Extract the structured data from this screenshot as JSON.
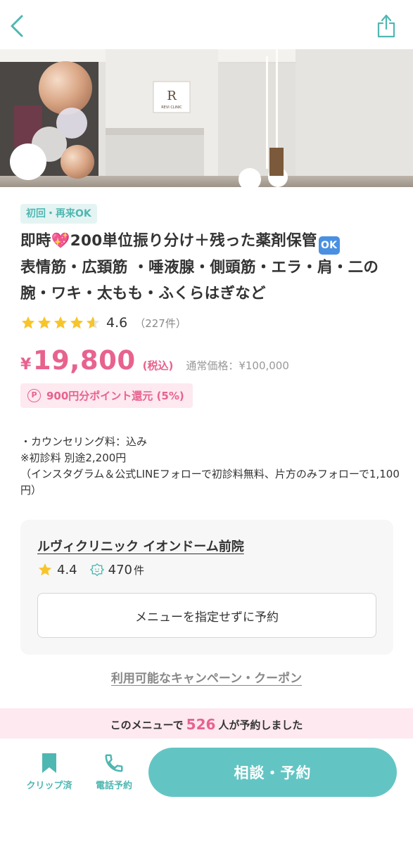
{
  "topbar": {
    "back_icon": "chevron-left-icon",
    "share_icon": "share-icon",
    "accent": "#4fb7b2"
  },
  "hero": {
    "logo_text": "REVI CLINIC",
    "logo_mark": "R"
  },
  "menu": {
    "badge": "初回・再来OK",
    "title_part1": "即時",
    "title_emoji1": "💖",
    "title_part2": "200単位振り分け＋残った薬剤保管",
    "title_emoji2": "OK",
    "title_part3": "表情筋・広頚筋 ・唾液腺・側頭筋・エラ・肩・二の腕・ワキ・太もも・ふくらはぎなど",
    "rating": "4.6",
    "rating_value": 4.6,
    "rating_count": "（227件）",
    "price_yen": "¥",
    "price": "19,800",
    "tax_label": "(税込)",
    "regular_price": "通常価格：¥100,000",
    "points_icon": "P",
    "points_text": "900円分ポイント還元 (5%)",
    "description": [
      "・カウンセリング料：込み",
      "※初診料 別途2,200円",
      "（インスタグラム＆公式LINEフォローで初診料無料、片方のみフォローで1,100円）"
    ]
  },
  "clinic": {
    "name": "ルヴィクリニック イオンドーム前院",
    "rating": "4.4",
    "reviews": "470",
    "reviews_unit": "件",
    "no_menu_button": "メニューを指定せずに予約"
  },
  "coupon_link": "利用可能なキャンペーン・クーポン",
  "booked": {
    "prefix": "このメニューで",
    "count": "526",
    "suffix": "人が予約しました"
  },
  "bottom": {
    "clip_label": "クリップ済",
    "tel_label": "電話予約",
    "reserve_label": "相談・予約"
  },
  "colors": {
    "teal": "#63c5c3",
    "pink": "#e8628e",
    "star": "#f7c52b"
  }
}
